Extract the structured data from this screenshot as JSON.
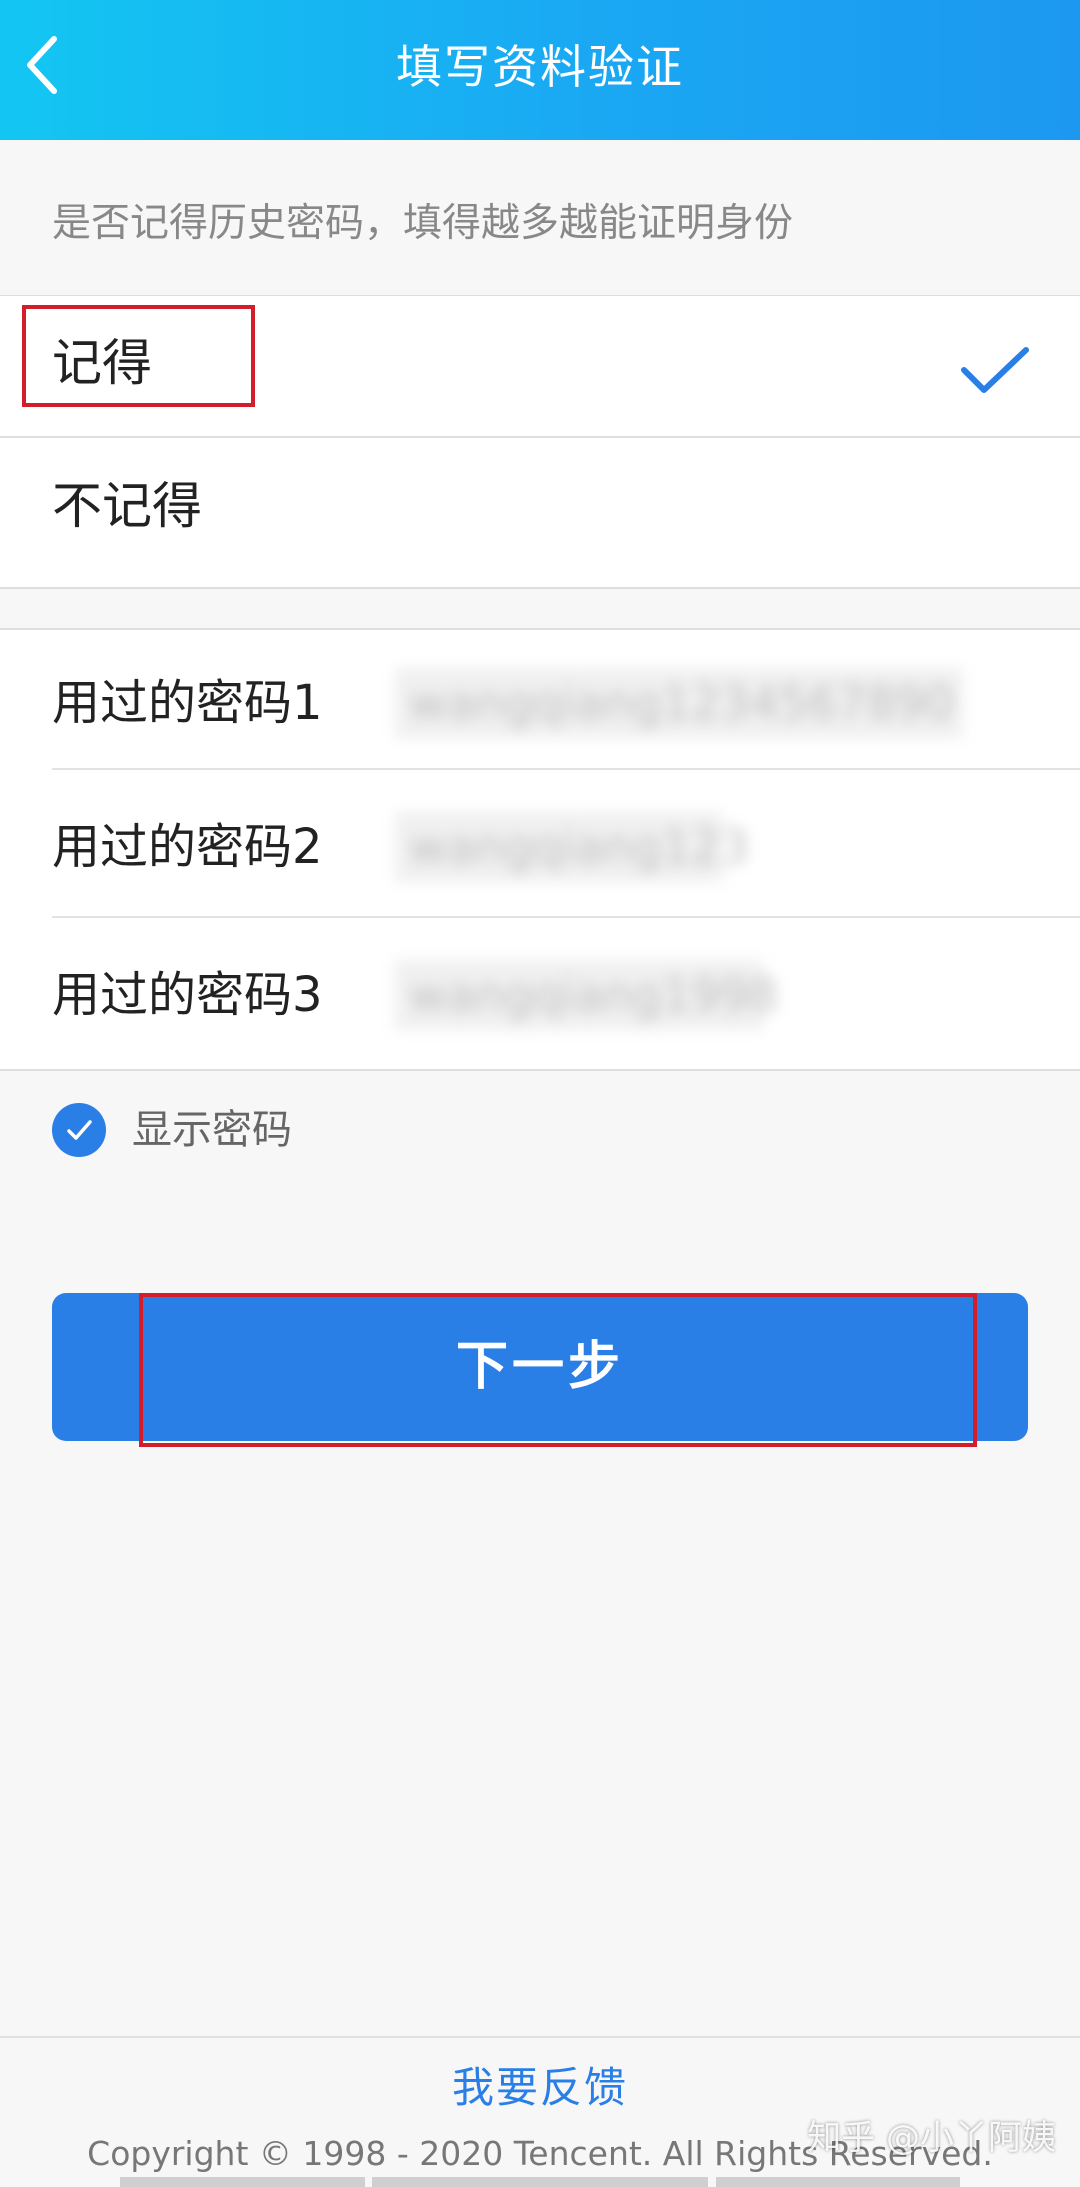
{
  "header": {
    "title": "填写资料验证",
    "back_icon": "chevron-left-icon"
  },
  "hint": "是否记得历史密码，填得越多越能证明身份",
  "options": [
    {
      "label": "记得",
      "selected": true
    },
    {
      "label": "不记得",
      "selected": false
    }
  ],
  "passwords": [
    {
      "label": "用过的密码1",
      "value": "wangqiang1234567890"
    },
    {
      "label": "用过的密码2",
      "value": "wangqiang123"
    },
    {
      "label": "用过的密码3",
      "value": "wangqiang1998"
    }
  ],
  "show_password": {
    "label": "显示密码",
    "checked": true
  },
  "next_button": "下一步",
  "feedback": "我要反馈",
  "copyright": "Copyright © 1998 - 2020 Tencent. All Rights Reserved.",
  "watermark": "知乎 @小丫阿姨",
  "colors": {
    "accent": "#2a7fe6",
    "header_gradient_start": "#13c6f2",
    "header_gradient_end": "#1c98f0",
    "highlight": "#d21e2a"
  }
}
